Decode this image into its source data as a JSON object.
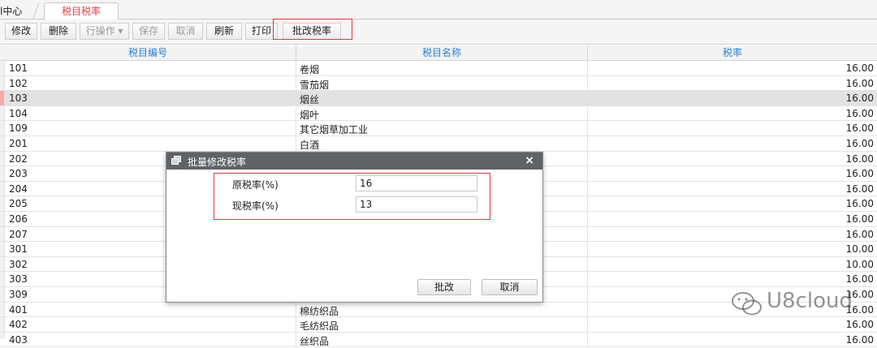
{
  "tabs": {
    "prev_label": "l中心",
    "active_label": "税目税率"
  },
  "toolbar": {
    "buttons": [
      {
        "label": "修改",
        "disabled": false
      },
      {
        "label": "删除",
        "disabled": false
      },
      {
        "label": "行操作 ▾",
        "disabled": true
      },
      {
        "label": "保存",
        "disabled": true
      },
      {
        "label": "取消",
        "disabled": true
      },
      {
        "label": "刷新",
        "disabled": false
      },
      {
        "label": "打印",
        "disabled": false
      },
      {
        "label": "批改税率",
        "disabled": false
      }
    ]
  },
  "grid": {
    "columns": [
      "税目编号",
      "税目名称",
      "税率"
    ],
    "rows": [
      {
        "code": "101",
        "name": "卷烟",
        "rate": "16.00"
      },
      {
        "code": "102",
        "name": "雪茄烟",
        "rate": "16.00"
      },
      {
        "code": "103",
        "name": "烟丝",
        "rate": "16.00"
      },
      {
        "code": "104",
        "name": "烟叶",
        "rate": "16.00"
      },
      {
        "code": "109",
        "name": "其它烟草加工业",
        "rate": "16.00"
      },
      {
        "code": "201",
        "name": "白酒",
        "rate": "16.00"
      },
      {
        "code": "202",
        "name": "",
        "rate": "16.00"
      },
      {
        "code": "203",
        "name": "",
        "rate": "16.00"
      },
      {
        "code": "204",
        "name": "",
        "rate": "16.00"
      },
      {
        "code": "205",
        "name": "",
        "rate": "16.00"
      },
      {
        "code": "206",
        "name": "",
        "rate": "16.00"
      },
      {
        "code": "207",
        "name": "",
        "rate": "16.00"
      },
      {
        "code": "301",
        "name": "",
        "rate": "10.00"
      },
      {
        "code": "302",
        "name": "",
        "rate": "10.00"
      },
      {
        "code": "303",
        "name": "",
        "rate": "16.00"
      },
      {
        "code": "309",
        "name": "",
        "rate": "16.00"
      },
      {
        "code": "401",
        "name": "棉纺织品",
        "rate": "16.00"
      },
      {
        "code": "402",
        "name": "毛纺织品",
        "rate": "16.00"
      },
      {
        "code": "403",
        "name": "丝织品",
        "rate": "16.00"
      }
    ],
    "selected_code": "103"
  },
  "dialog": {
    "title": "批量修改税率",
    "close_glyph": "×",
    "original_rate_label": "原税率(%)",
    "original_rate_value": "16",
    "new_rate_label": "现税率(%)",
    "new_rate_value": "13",
    "confirm_label": "批改",
    "cancel_label": "取消"
  },
  "watermark": {
    "text": "U8cloud"
  },
  "colors": {
    "highlight": "#e8333a",
    "header_text": "#2c7fd1",
    "tab_active_text": "#e0424a",
    "dialog_title_bg": "#5f6266"
  }
}
